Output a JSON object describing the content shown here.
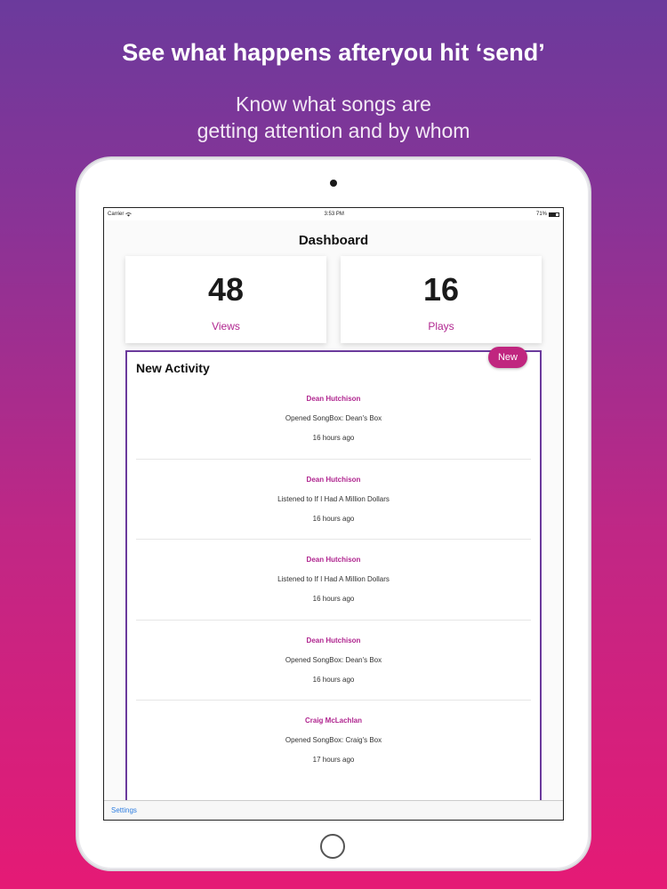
{
  "headline": "See what happens afteryou hit ‘send’",
  "subline": [
    "Know what songs are",
    "getting attention and by whom"
  ],
  "statusbar": {
    "carrier": "Carrier",
    "time": "3:53 PM",
    "battery": "71%",
    "battery_level": 0.71
  },
  "dashboard": {
    "title": "Dashboard",
    "stats": [
      {
        "value": "48",
        "label": "Views"
      },
      {
        "value": "16",
        "label": "Plays"
      }
    ]
  },
  "activity": {
    "title": "New Activity",
    "badge": "New",
    "items": [
      {
        "name": "Dean Hutchison",
        "action": "Opened SongBox: Dean's Box",
        "time": "16 hours ago"
      },
      {
        "name": "Dean Hutchison",
        "action": "Listened to If I Had A Million Dollars",
        "time": "16 hours ago"
      },
      {
        "name": "Dean Hutchison",
        "action": "Listened to If I Had A Million Dollars",
        "time": "16 hours ago"
      },
      {
        "name": "Dean Hutchison",
        "action": "Opened SongBox: Dean's Box",
        "time": "16 hours ago"
      },
      {
        "name": "Craig McLachlan",
        "action": "Opened SongBox: Craig's Box",
        "time": "17 hours ago"
      }
    ]
  },
  "tabbar": {
    "settings": "Settings"
  },
  "colors": {
    "accent": "#b0258f",
    "frame": "#6b3a9c",
    "link": "#2d7de0"
  }
}
